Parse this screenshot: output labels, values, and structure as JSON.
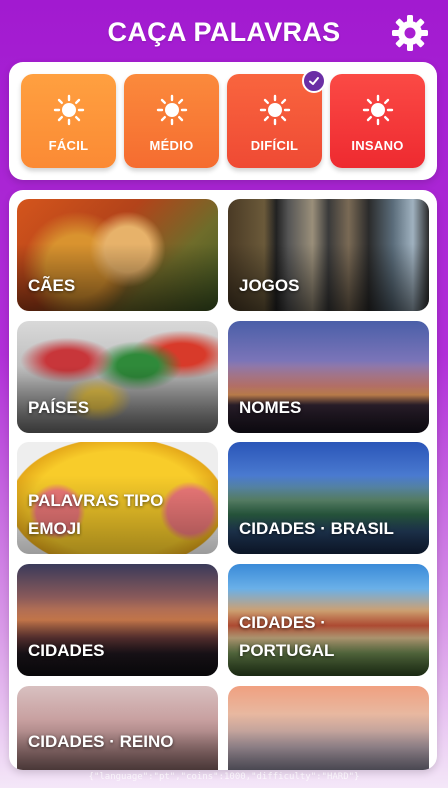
{
  "header": {
    "title": "CAÇA PALAVRAS",
    "settings_icon": "gear-icon"
  },
  "difficulty": {
    "selected": "DIFÍCIL",
    "options": [
      {
        "label": "FÁCIL",
        "icon": "sun-icon",
        "color_top": "#ffa040",
        "color_bottom": "#fb8a34"
      },
      {
        "label": "MÉDIO",
        "icon": "sun-icon",
        "color_top": "#fb8a3c",
        "color_bottom": "#f56c30"
      },
      {
        "label": "DIFÍCIL",
        "icon": "sun-icon",
        "color_top": "#f9653e",
        "color_bottom": "#ef4a34"
      },
      {
        "label": "INSANO",
        "icon": "sun-icon",
        "color_top": "#fb4a45",
        "color_bottom": "#ee2a30"
      }
    ]
  },
  "categories": [
    {
      "label": "CÃES"
    },
    {
      "label": "JOGOS"
    },
    {
      "label": "PAÍSES"
    },
    {
      "label": "NOMES"
    },
    {
      "line1": "PALAVRAS TIPO",
      "line2": "EMOJI"
    },
    {
      "label": "CIDADES · BRASIL"
    },
    {
      "label": "CIDADES"
    },
    {
      "line1": "CIDADES ·",
      "line2": "PORTUGAL"
    },
    {
      "label": "CIDADES · REINO"
    },
    {
      "label": ""
    }
  ],
  "footer": {
    "debug_text": "{\"language\":\"pt\",\"coins\":1000,\"difficulty\":\"HARD\"}"
  },
  "colors": {
    "accent": "#a21ad0",
    "check": "#6b2fa5"
  }
}
